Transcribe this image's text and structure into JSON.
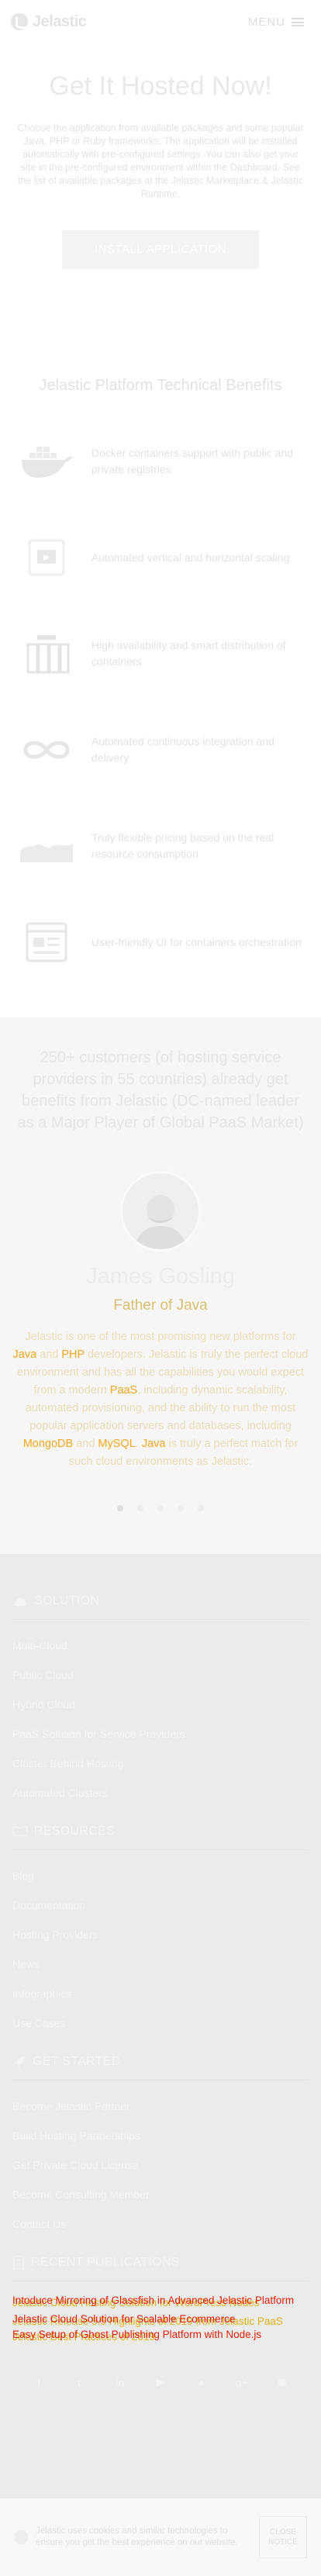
{
  "header": {
    "logo": "Jelastic",
    "menu_label": "MENU"
  },
  "hosted": {
    "title": "Get It Hosted Now!",
    "description": "Choose the application from available packages and some popular Java, PHP or Ruby frameworks. The application will be installed automatically with pre-configured settings. You can also get your site in the pre-configured environment within the Dashboard. See the list of available packages at the Jelastic Marketplace & Jelastic Runtime.",
    "install_label": "INSTALL APPLICATION"
  },
  "benefits": {
    "title": "Jelastic Platform Technical Benefits",
    "items": [
      {
        "icon": "docker-whale-icon",
        "text": "Docker containers support with public and private registries"
      },
      {
        "icon": "auto-scaling-icon",
        "text": "Automated vertical and horizontal scaling"
      },
      {
        "icon": "server-rack-icon",
        "text": "High availability and smart distribution of containers"
      },
      {
        "icon": "infinity-icon",
        "text": "Automated continuous integration and delivery"
      },
      {
        "icon": "area-chart-icon",
        "text": "Truly flexible pricing based on the real resource consumption"
      },
      {
        "icon": "dashboard-window-icon",
        "text": "User-friendly UI for containers orchestration"
      }
    ]
  },
  "customers": {
    "intro": "250+ customers (of hosting service providers in 55 countries) already get benefits from Jelastic (DC-named leader as a Major Player of Global PaaS Market)",
    "person_name": "James Gosling",
    "person_role": "Father of Java",
    "quote": [
      {
        "text": "Jelastic is one of the most promising new platforms for Java and PHP developers. Jelastic is truly the perfect cloud environment and has all the capabilities you would expect from a modern PaaS, including dynamic scalability, automated provisioning, and the ability to run the most popular application servers and databases, including MongoDB and MySQL. Java is truly a perfect match for such cloud environments as Jelastic."
      }
    ],
    "quote_highlights": [
      "Java",
      "PHP",
      "PaaS",
      "MongoDB",
      "MySQL",
      "Java"
    ],
    "slide_count": 5,
    "active_slide": 1
  },
  "footer": {
    "sections": [
      {
        "icon": "cloud-icon",
        "title": "SOLUTION",
        "links": [
          "Multi-Cloud",
          "Public Cloud",
          "Hybrid Cloud",
          "PaaS Solution for Service Providers",
          "Cluster Behind Hosting",
          "Automated Clusters"
        ]
      },
      {
        "icon": "book-icon",
        "title": "RESOURCES",
        "links": [
          "Blog",
          "Documentation",
          "Hosting Providers",
          "News",
          "Infographics",
          "Use Cases"
        ]
      },
      {
        "icon": "rocket-icon",
        "title": "GET STARTED",
        "links": [
          "Become Jelastic Partner",
          "Build Hosting Partnerships",
          "Get Private Cloud License",
          "Become Consulting Member",
          "Contact Us"
        ]
      }
    ],
    "publications": {
      "icon": "document-icon",
      "title": "RECENT PUBLICATIONS",
      "items": [
        {
          "base": "Intoduce Mirroring of Glassfish in Advanced Jelastic Platform",
          "overlay": "Jelastic Cloud Hosting Solution for WordPress Nodes"
        },
        {
          "base": "Jelastic Cloud Solution for Scalable Ecommerce",
          "overlay": "Jelastic Release 5.5 Highlights of 2019 from Jelastic PaaS"
        },
        {
          "base": "Easy Setup of Ghost Publishing Platform with Node.js",
          "overlay": "Jelastic Best Practices of 2019"
        }
      ]
    },
    "socials": [
      "facebook-icon",
      "twitter-icon",
      "linkedin-icon",
      "youtube-icon",
      "github-icon",
      "googleplus-icon",
      "rss-icon"
    ]
  },
  "cookie": {
    "text": "Jelastic uses cookies and similar technologies to ensure you get the best experience on our website.",
    "button": "CLOSE NOTICE"
  }
}
